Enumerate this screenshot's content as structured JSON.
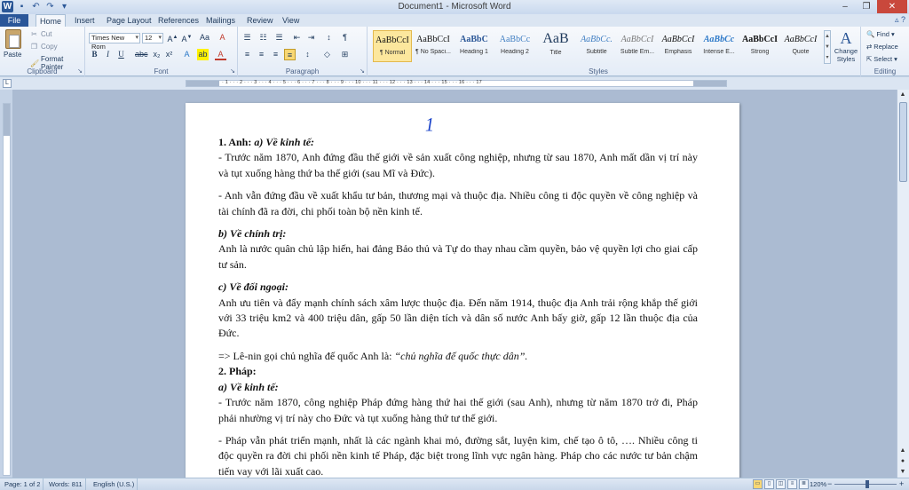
{
  "window": {
    "title": "Document1 - Microsoft Word"
  },
  "tabs": [
    "File",
    "Home",
    "Insert",
    "Page Layout",
    "References",
    "Mailings",
    "Review",
    "View"
  ],
  "clipboard": {
    "paste": "Paste",
    "cut": "Cut",
    "copy": "Copy",
    "format_painter": "Format Painter",
    "label": "Clipboard"
  },
  "font": {
    "name": "Times New Rom",
    "size": "12",
    "label": "Font"
  },
  "paragraph": {
    "label": "Paragraph"
  },
  "styles": {
    "label": "Styles",
    "items": [
      {
        "sample": "AaBbCcI",
        "name": "¶ Normal"
      },
      {
        "sample": "AaBbCcI",
        "name": "¶ No Spaci..."
      },
      {
        "sample": "AaBbC",
        "name": "Heading 1"
      },
      {
        "sample": "AaBbCc",
        "name": "Heading 2"
      },
      {
        "sample": "AaB",
        "name": "Title"
      },
      {
        "sample": "AaBbCc.",
        "name": "Subtitle"
      },
      {
        "sample": "AaBbCcI",
        "name": "Subtle Em..."
      },
      {
        "sample": "AaBbCcI",
        "name": "Emphasis"
      },
      {
        "sample": "AaBbCc",
        "name": "Intense E..."
      },
      {
        "sample": "AaBbCcI",
        "name": "Strong"
      },
      {
        "sample": "AaBbCcI",
        "name": "Quote"
      }
    ],
    "change_styles": "Change Styles"
  },
  "editing": {
    "find": "Find",
    "replace": "Replace",
    "select": "Select",
    "label": "Editing"
  },
  "document": {
    "pen_mark": "1",
    "lines": {
      "h1_num": "1. Anh:",
      "h1_sub": "a) Về kinh tế:",
      "p1": "- Trước năm 1870, Anh đứng đầu thế giới về sản xuất công nghiệp, nhưng từ sau 1870, Anh mất dần vị trí này và tụt xuống hàng thứ ba thế giới (sau Mĩ và Đức).",
      "p2": "- Anh vẫn đứng đầu về xuất khẩu tư bản, thương mại và thuộc địa. Nhiều công ti độc quyền về công nghiệp và tài chính đã ra đời, chi phối toàn bộ nền kinh tế.",
      "h_b": "b) Về chính trị:",
      "p3": "Anh là nước quân chủ lập hiến, hai đảng Bảo thủ và Tự do thay nhau cầm quyền, bảo vệ quyền lợi cho giai cấp tư sản.",
      "h_c": "c) Về đối ngoại:",
      "p4": "Anh ưu tiên và đẩy mạnh chính sách xâm lược thuộc địa. Đến năm 1914, thuộc địa Anh trải rộng khắp thế giới với 33 triệu km2 và 400 triệu dân, gấp 50 lần diện tích và dân số nước Anh bấy giờ, gấp 12 lần thuộc địa của Đức.",
      "p5_pre": "=> Lê-nin gọi chủ nghĩa đế quốc Anh là: ",
      "p5_quote": "“chủ nghĩa đế quốc thực dân”.",
      "h2": "2. Pháp:",
      "h2_sub": "a) Về kinh tế:",
      "p6": "- Trước năm 1870, công nghiệp Pháp đứng hàng thứ hai thế giới (sau Anh), nhưng từ năm 1870 trở đi, Pháp phải nhường vị trí này cho Đức và tụt xuống hàng thứ tư thế giới.",
      "p7": "- Pháp vẫn phát triển mạnh, nhất là các ngành khai mỏ, đường sắt, luyện kim, chế tạo ô tô, …. Nhiều công ti độc quyền ra đời chi phối nền kinh tế Pháp, đặc biệt trong lĩnh vực ngân hàng. Pháp cho các nước tư bản chậm tiến vay với lãi xuất cao."
    }
  },
  "status": {
    "page": "Page: 1 of 2",
    "words": "Words: 811",
    "language": "English (U.S.)",
    "zoom": "120%"
  }
}
